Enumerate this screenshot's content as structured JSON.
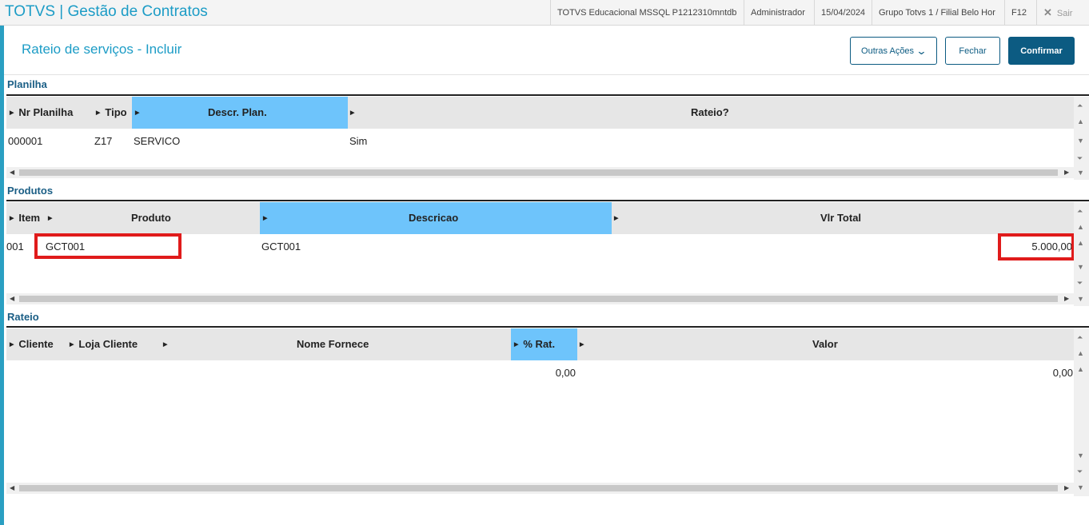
{
  "topbar": {
    "app_title": "TOTVS | Gestão de Contratos",
    "environment": "TOTVS Educacional MSSQL P1212310mntdb",
    "user": "Administrador",
    "date": "15/04/2024",
    "branch": "Grupo Totvs 1 / Filial Belo Hor",
    "shortcut": "F12",
    "exit_label": "Sair"
  },
  "page": {
    "title": "Rateio de serviços - Incluir",
    "buttons": {
      "other_actions": "Outras Ações",
      "close": "Fechar",
      "confirm": "Confirmar"
    }
  },
  "planilha": {
    "label": "Planilha",
    "columns": [
      "Nr Planilha",
      "Tipo",
      "Descr. Plan.",
      "Rateio?"
    ],
    "rows": [
      [
        "000001",
        "Z17",
        "SERVICO",
        "Sim"
      ]
    ]
  },
  "produtos": {
    "label": "Produtos",
    "columns": [
      "Item",
      "Produto",
      "Descricao",
      "Vlr Total"
    ],
    "rows": [
      [
        "001",
        "GCT001",
        "GCT001",
        "5.000,00"
      ]
    ]
  },
  "rateio": {
    "label": "Rateio",
    "columns": [
      "Cliente",
      "Loja Cliente",
      "Nome Fornece",
      "% Rat.",
      "Valor"
    ],
    "rows": [
      [
        "",
        "",
        "",
        "0,00",
        "0,00"
      ]
    ]
  },
  "colors": {
    "accent": "#1c9cc6",
    "primary_button": "#0c5b82",
    "selected_column": "#6ec4fb",
    "highlight": "#e01b1b"
  }
}
